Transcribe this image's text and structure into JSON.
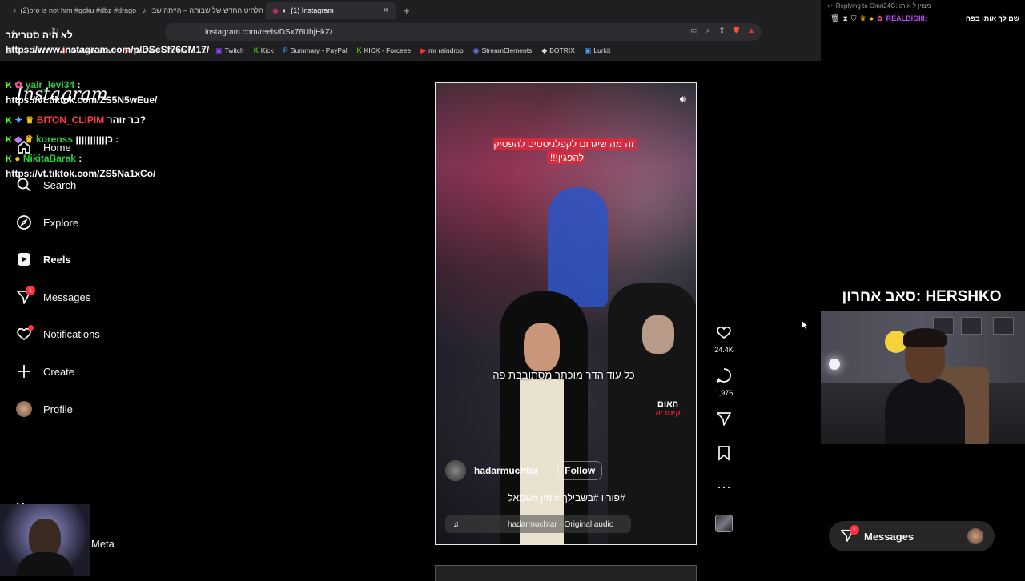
{
  "browser": {
    "tabs": [
      {
        "title": "(2)bro is not him #goku #dbz #drago",
        "icon": "tiktok-icon"
      },
      {
        "title": "הלהיט החדש של שבותה – הייתה שבו",
        "icon": "tiktok-icon"
      },
      {
        "title": "(1) Instagram",
        "icon": "instagram-icon",
        "active": true
      }
    ],
    "close_glyph": "✕",
    "new_tab_glyph": "+",
    "url": "instagram.com/reels/DSx76UhjHkZ/",
    "bookmarks": [
      {
        "label": "Shhhh",
        "icon": "folder-icon"
      },
      {
        "label": "YouTube Music",
        "icon": "youtube-music-icon"
      },
      {
        "label": "YouTube",
        "icon": "youtube-icon"
      },
      {
        "label": "Home / X",
        "icon": "x-icon"
      },
      {
        "label": "Twitch",
        "icon": "twitch-icon"
      },
      {
        "label": "Kick",
        "icon": "kick-icon"
      },
      {
        "label": "Summary - PayPal",
        "icon": "paypal-icon"
      },
      {
        "label": "KICK - Forceee",
        "icon": "kick-icon"
      },
      {
        "label": "mr raindrop",
        "icon": "youtube-icon"
      },
      {
        "label": "StreamElements",
        "icon": "streamelements-icon"
      },
      {
        "label": "BOTRIX",
        "icon": "botrix-icon"
      },
      {
        "label": "Lurkit",
        "icon": "lurkit-icon"
      }
    ]
  },
  "instagram": {
    "logo": "Instagram",
    "nav": [
      {
        "label": "Home",
        "icon": "home-icon"
      },
      {
        "label": "Search",
        "icon": "search-icon"
      },
      {
        "label": "Explore",
        "icon": "explore-icon"
      },
      {
        "label": "Reels",
        "icon": "reels-icon",
        "active": true
      },
      {
        "label": "Messages",
        "icon": "messages-icon",
        "badge": "1"
      },
      {
        "label": "Notifications",
        "icon": "heart-icon",
        "dot": true
      },
      {
        "label": "Create",
        "icon": "plus-icon"
      },
      {
        "label": "Profile",
        "icon": "avatar"
      }
    ],
    "more_label": "More",
    "meta_label": "Meta",
    "reel": {
      "top_caption": "זה מה שיגרום לקפלניסטים להפסיק להפגין!!!",
      "mid_caption": "כל עוד הדר מוכתר מסתובבת פה",
      "hoodie_text_1": "האוֹם",
      "hoodie_text_2": "קיסריה",
      "author": "hadarmuchtar",
      "follow_label": "Follow",
      "hashtags": "#פוריו #בשבילך #ימין #שמאל",
      "audio": "hadarmuchtar · Original audio",
      "likes": "24.4K",
      "comments": "1,976"
    },
    "messages_pill": {
      "label": "Messages",
      "badge": "1"
    }
  },
  "stream_overlay": {
    "reply_header": "Replying to Omri24G: מצוין ל אותו",
    "top_user": "REALBIGIII:",
    "top_msg": "שם לך אותו בפה",
    "chat": [
      {
        "user": "",
        "text": "לא היה סטרימר https://www.instagram.com/p/DScSf76CM17/"
      },
      {
        "user": "yair_levi34",
        "text": ": https://vt.tiktok.com/ZS5N5wEue/"
      },
      {
        "user": "BITON_CLIPIM",
        "text": "?בר זוהר"
      },
      {
        "user": "korenss",
        "text": ": כןןןןןןןןןןן"
      },
      {
        "user": "NikitaBarak",
        "text": ": https://vt.tiktok.com/ZS5Na1xCo/"
      }
    ],
    "sub_banner": "סאב אחרון: HERSHKO"
  },
  "colors": {
    "accent_red": "#ff3040",
    "kick_green": "#53fc18",
    "bg": "#000000"
  }
}
